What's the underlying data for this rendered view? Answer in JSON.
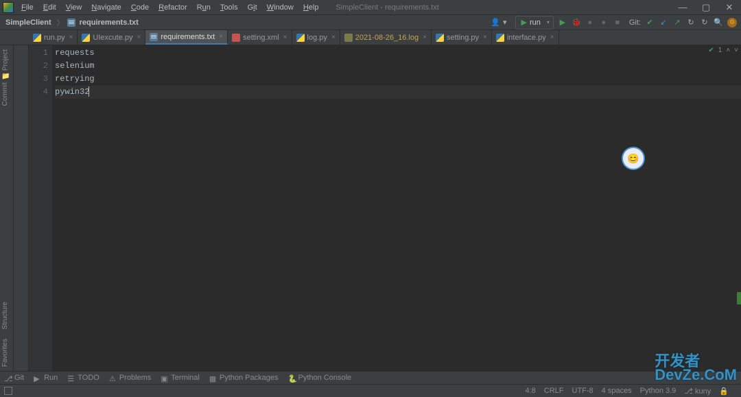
{
  "window": {
    "title": "SimpleClient - requirements.txt"
  },
  "menu": {
    "file": "File",
    "edit": "Edit",
    "view": "View",
    "navigate": "Navigate",
    "code": "Code",
    "refactor": "Refactor",
    "run": "Run",
    "tools": "Tools",
    "git": "Git",
    "window": "Window",
    "help": "Help"
  },
  "breadcrumb": {
    "project": "SimpleClient",
    "file": "requirements.txt"
  },
  "toolbar": {
    "run_config": "run",
    "git_label": "Git:"
  },
  "tabs": [
    {
      "label": "run.py",
      "icon": "py",
      "active": false
    },
    {
      "label": "UIexcute.py",
      "icon": "py",
      "active": false
    },
    {
      "label": "requirements.txt",
      "icon": "txt",
      "active": true
    },
    {
      "label": "setting.xml",
      "icon": "xml",
      "active": false
    },
    {
      "label": "log.py",
      "icon": "py",
      "active": false
    },
    {
      "label": "2021-08-26_16.log",
      "icon": "log",
      "active": false,
      "highlight": true
    },
    {
      "label": "setting.py",
      "icon": "py",
      "active": false
    },
    {
      "label": "interface.py",
      "icon": "py",
      "active": false
    }
  ],
  "left_tools": {
    "project": "Project",
    "commit": "Commit",
    "structure": "Structure",
    "favorites": "Favorites"
  },
  "editor": {
    "lines": [
      "requests",
      "selenium",
      "retrying",
      "pywin32"
    ],
    "cursor_line": 4,
    "inspections": {
      "ok_count": "1"
    }
  },
  "tool_windows": {
    "git": "Git",
    "run": "Run",
    "todo": "TODO",
    "problems": "Problems",
    "terminal": "Terminal",
    "python_packages": "Python Packages",
    "python_console": "Python Console"
  },
  "status_bar": {
    "position": "4:8",
    "line_sep": "CRLF",
    "encoding": "UTF-8",
    "indent": "4 spaces",
    "interpreter": "Python 3.9",
    "branch": "kuny",
    "trailer": ""
  },
  "watermark": {
    "line1": "开发者",
    "line2": "DevZe.CoM"
  },
  "glyphs": {
    "min": "—",
    "max": "▢",
    "close": "✕",
    "user": "👤",
    "dropdown": "▾",
    "play": "▶",
    "bug": "🐞",
    "dot": "●",
    "stop": "■",
    "check": "✔",
    "arrow_down": "↙",
    "arrow_up": "↗",
    "clock": "↻",
    "search": "🔍",
    "gear": "⚙",
    "branch": "⎇",
    "run_tri": "▶",
    "chev_up": "˄",
    "chev_down": "˅",
    "bot": "😊",
    "lock": "🔒",
    "sep": "〉",
    "folder": "📁",
    "todo": "☰",
    "warn": "⚠",
    "term": "▣",
    "pkg": "▦",
    "pycon": "🐍"
  }
}
